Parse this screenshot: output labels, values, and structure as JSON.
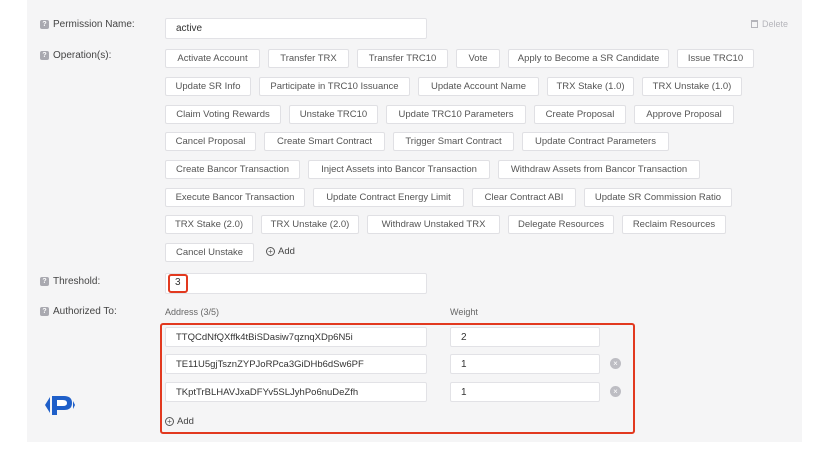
{
  "permission": {
    "name_label": "Permission Name:",
    "name_value": "active",
    "delete_label": "Delete",
    "operations_label": "Operation(s):",
    "operations": [
      "Activate Account",
      "Transfer TRX",
      "Transfer TRC10",
      "Vote",
      "Apply to Become a SR Candidate",
      "Issue TRC10",
      "Update SR Info",
      "Participate in TRC10 Issuance",
      "Update Account Name",
      "TRX Stake (1.0)",
      "TRX Unstake (1.0)",
      "Claim Voting Rewards",
      "Unstake TRC10",
      "Update TRC10 Parameters",
      "Create Proposal",
      "Approve Proposal",
      "Cancel Proposal",
      "Create Smart Contract",
      "Trigger Smart Contract",
      "Update Contract Parameters",
      "Create Bancor Transaction",
      "Inject Assets into Bancor Transaction",
      "Withdraw Assets from Bancor Transaction",
      "Execute Bancor Transaction",
      "Update Contract Energy Limit",
      "Clear Contract ABI",
      "Update SR Commission Ratio",
      "TRX Stake (2.0)",
      "TRX Unstake (2.0)",
      "Withdraw Unstaked TRX",
      "Delegate Resources",
      "Reclaim Resources",
      "Cancel Unstake"
    ],
    "add_operation_label": "Add",
    "threshold_label": "Threshold:",
    "threshold_value": "3",
    "authorized_label": "Authorized To:",
    "address_header": "Address (3/5)",
    "weight_header": "Weight",
    "keys": [
      {
        "address": "TTQCdNfQXffk4tBiSDasiw7qznqXDp6N5i",
        "weight": "2"
      },
      {
        "address": "TE11U5gjTsznZYPJoRPca3GiDHb6dSw6PF",
        "weight": "1"
      },
      {
        "address": "TKptTrBLHAVJxaDFYv5SLJyhPo6nuDeZfh",
        "weight": "1"
      }
    ],
    "add_key_label": "Add",
    "accent_color": "#e2391f"
  }
}
